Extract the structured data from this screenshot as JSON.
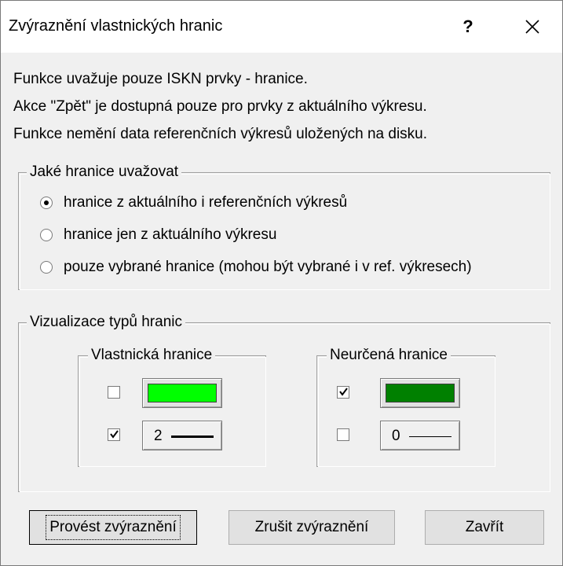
{
  "dialog": {
    "title": "Zvýraznění vlastnických hranic",
    "help_label": "?",
    "close_icon": "close-icon"
  },
  "info_lines": [
    "Funkce uvažuje pouze ISKN prvky - hranice.",
    "Akce \"Zpět\" je dostupná pouze pro prvky z aktuálního výkresu.",
    "Funkce nemění data referenčních výkresů uložených na disku."
  ],
  "boundaries_group": {
    "legend": "Jaké hranice uvažovat",
    "options": [
      {
        "label": "hranice z aktuálního i referenčních výkresů",
        "selected": true
      },
      {
        "label": "hranice jen z aktuálního výkresu",
        "selected": false
      },
      {
        "label": "pouze vybrané hranice (mohou být vybrané i v ref. výkresech)",
        "selected": false
      }
    ]
  },
  "visualization_group": {
    "legend": "Vizualizace typů hranic",
    "ownership": {
      "legend": "Vlastnická hranice",
      "color_checked": false,
      "color": "#00ff00",
      "width_checked": true,
      "width_value": "2"
    },
    "undetermined": {
      "legend": "Neurčená hranice",
      "color_checked": true,
      "color": "#008000",
      "width_checked": false,
      "width_value": "0"
    }
  },
  "buttons": {
    "apply": "Provést zvýraznění",
    "cancel_highlight": "Zrušit zvýraznění",
    "close": "Zavřít"
  }
}
